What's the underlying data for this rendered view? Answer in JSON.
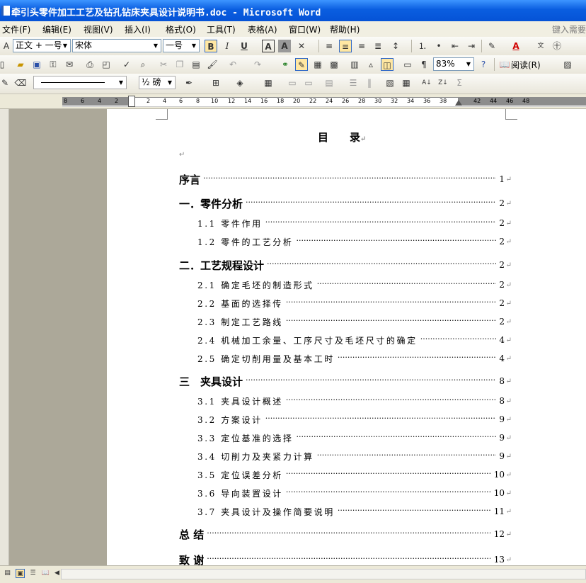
{
  "window": {
    "title": "牵引头零件加工工艺及钻孔钻床夹具设计说明书.doc - Microsoft Word"
  },
  "menubar": {
    "items": [
      "文件(F)",
      "编辑(E)",
      "视图(V)",
      "插入(I)",
      "格式(O)",
      "工具(T)",
      "表格(A)",
      "窗口(W)",
      "帮助(H)"
    ],
    "help_prompt": "键入需要"
  },
  "toolbar": {
    "style": "正文 + 一号",
    "font": "宋体",
    "size": "一号",
    "zoom": "83%",
    "read_label": "阅读(R)",
    "line_weight": "½ 磅"
  },
  "ruler": {
    "numbers": [
      "8",
      "6",
      "4",
      "2",
      "2",
      "4",
      "6",
      "8",
      "10",
      "12",
      "14",
      "16",
      "18",
      "20",
      "22",
      "24",
      "26",
      "28",
      "30",
      "32",
      "34",
      "36",
      "38",
      "42",
      "44",
      "46",
      "48"
    ]
  },
  "document": {
    "title": "目　　录",
    "para_mark": "↵",
    "toc": [
      {
        "label": "序言",
        "page": "1",
        "level": 1
      },
      {
        "label": "一．零件分析",
        "page": "2",
        "level": 1
      },
      {
        "label": "1.1 零件作用",
        "page": "2",
        "level": 2
      },
      {
        "label": "1.2 零件的工艺分析",
        "page": "2",
        "level": 2
      },
      {
        "label": "二．工艺规程设计",
        "page": "2",
        "level": 1
      },
      {
        "label": "2.1 确定毛坯的制造形式",
        "page": "2",
        "level": 2
      },
      {
        "label": "2.2 基面的选择传",
        "page": "2",
        "level": 2
      },
      {
        "label": "2.3 制定工艺路线",
        "page": "2",
        "level": 2
      },
      {
        "label": "2.4 机械加工余量、工序尺寸及毛坯尺寸的确定",
        "page": "4",
        "level": 2
      },
      {
        "label": "2.5 确定切削用量及基本工时",
        "page": "4",
        "level": 2
      },
      {
        "label": "三　夹具设计",
        "page": "8",
        "level": 1
      },
      {
        "label": "3.1 夹具设计概述",
        "page": "8",
        "level": 2
      },
      {
        "label": "3.2 方案设计",
        "page": "9",
        "level": 2
      },
      {
        "label": "3.3 定位基准的选择",
        "page": "9",
        "level": 2
      },
      {
        "label": "3.4 切削力及夹紧力计算",
        "page": "9",
        "level": 2
      },
      {
        "label": "3.5 定位误差分析",
        "page": "10",
        "level": 2
      },
      {
        "label": "3.6 导向装置设计",
        "page": "10",
        "level": 2
      },
      {
        "label": "3.7 夹具设计及操作简要说明",
        "page": "11",
        "level": 2
      },
      {
        "label": "总 结",
        "page": "12",
        "level": 1
      },
      {
        "label": "致 谢",
        "page": "13",
        "level": 1
      }
    ]
  }
}
